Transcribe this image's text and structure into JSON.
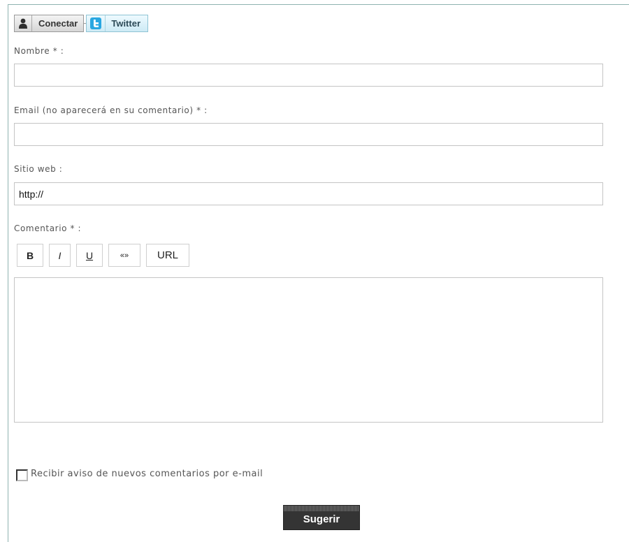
{
  "connect": {
    "connect_label": "Conectar",
    "twitter_label": "Twitter",
    "connect_icon": "user-icon",
    "twitter_icon": "twitter-icon",
    "twitter_color": "#29a7e1"
  },
  "form": {
    "name_label": "Nombre * :",
    "name_value": "",
    "email_label": "Email (no aparecerá en su comentario) * :",
    "email_value": "",
    "website_label": "Sitio web :",
    "website_value": "http://",
    "comment_label": "Comentario * :",
    "comment_value": "",
    "toolbar": {
      "bold": "B",
      "italic": "I",
      "underline": "U",
      "quote": "«»",
      "url": "URL"
    },
    "notify_label": "Recibir aviso de nuevos comentarios por e-mail",
    "notify_checked": false,
    "submit_label": "Sugerir"
  }
}
